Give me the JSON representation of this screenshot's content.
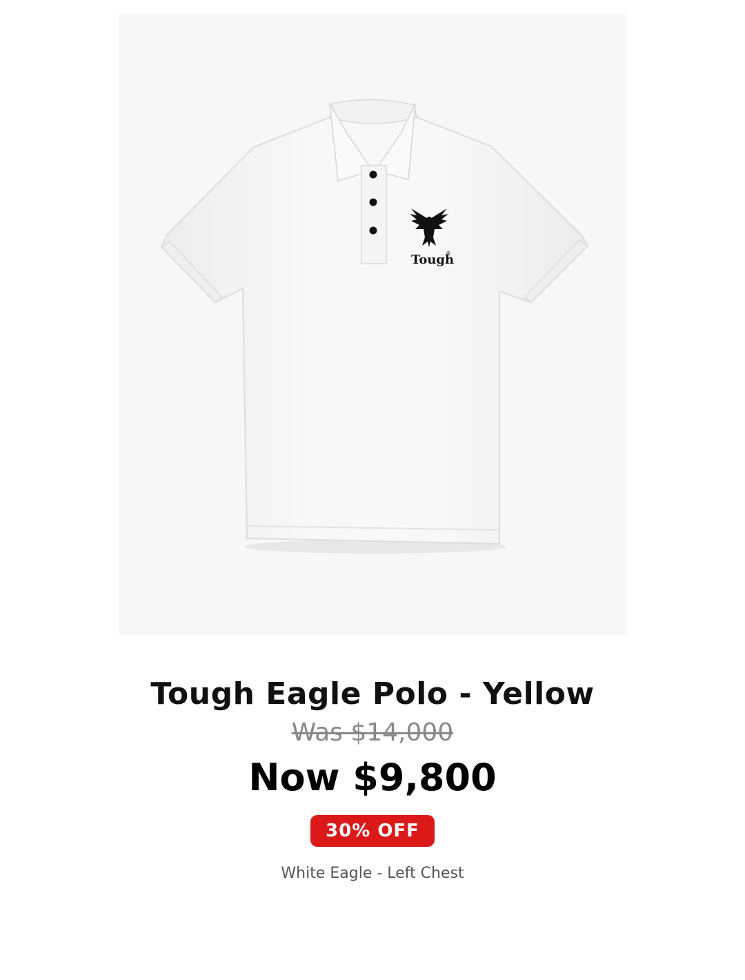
{
  "product": {
    "image_alt": "Tough Eagle Polo",
    "logo_text": "Tough",
    "title": "Tough Eagle Polo - Yellow",
    "was_price": "Was $14,000",
    "now_price": "Now $9,800",
    "discount_badge": "30% OFF",
    "variant": "White Eagle - Left Chest"
  },
  "colors": {
    "badge_bg": "#dc1919",
    "badge_text": "#ffffff",
    "old_price": "#888888",
    "title": "#111111",
    "shirt": "#ffffff",
    "logo": "#111111"
  }
}
